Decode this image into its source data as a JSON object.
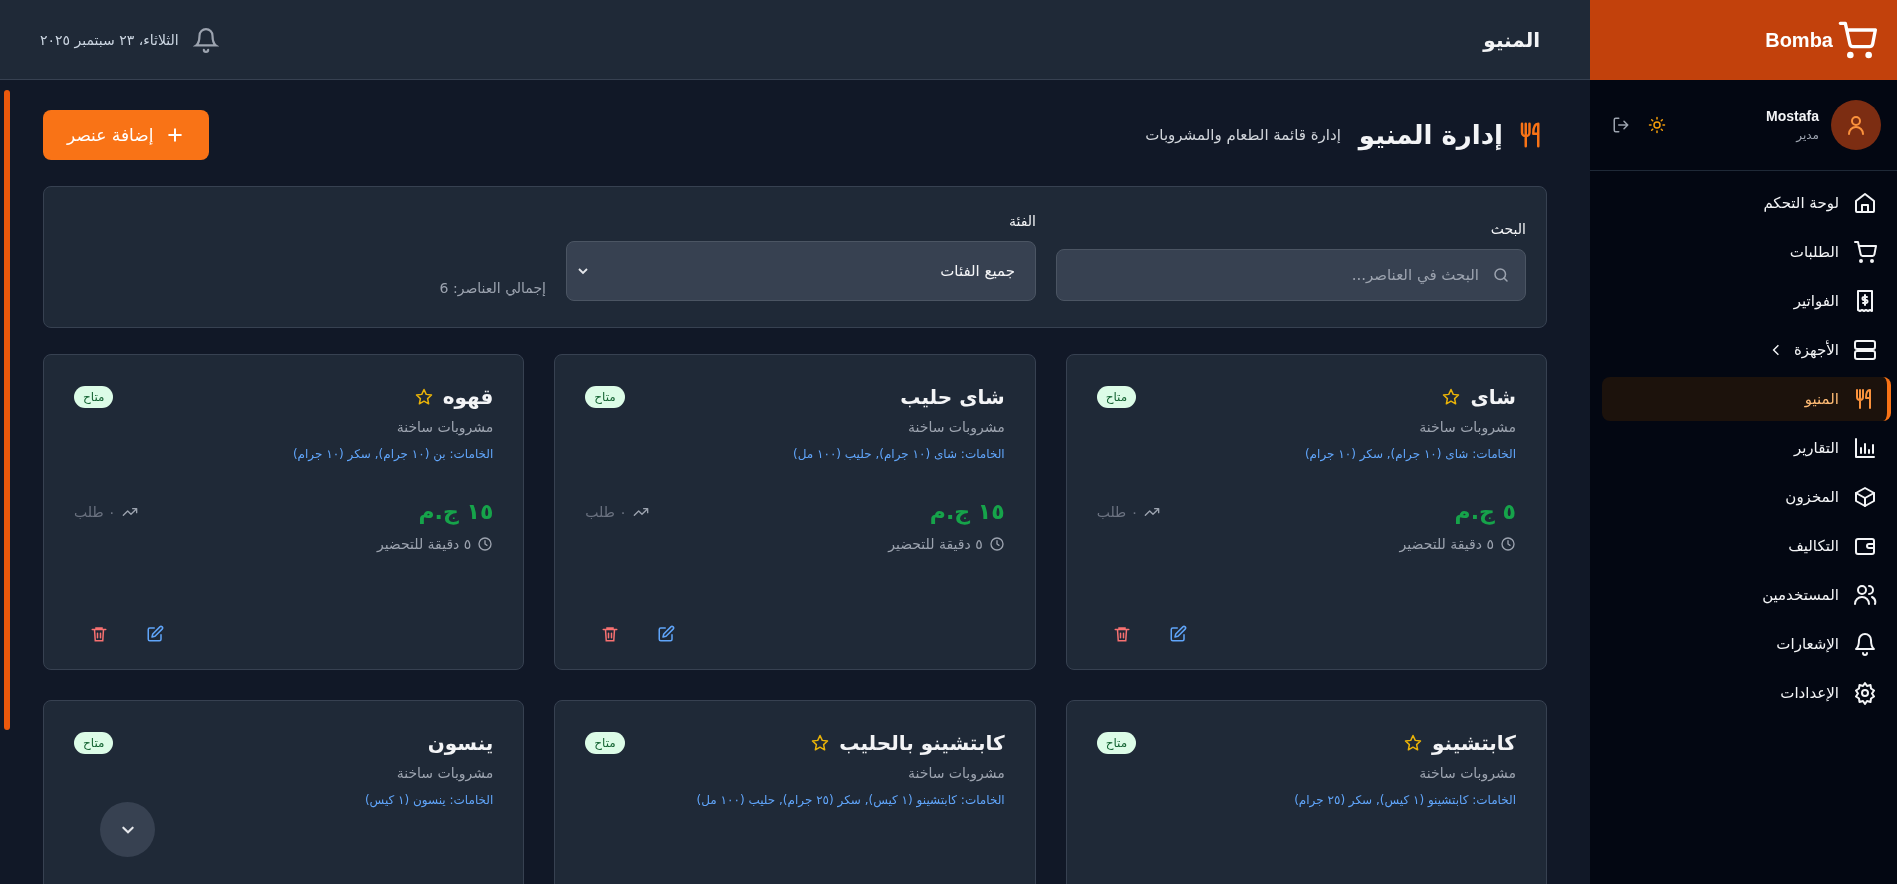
{
  "brand": {
    "name": "Bomba"
  },
  "user": {
    "name": "Mostafa",
    "role": "مدير"
  },
  "sidebar": {
    "items": [
      {
        "label": "لوحة التحكم",
        "selected": false,
        "expandable": false
      },
      {
        "label": "الطلبات",
        "selected": false,
        "expandable": false
      },
      {
        "label": "الفواتير",
        "selected": false,
        "expandable": false
      },
      {
        "label": "الأجهزة",
        "selected": false,
        "expandable": true
      },
      {
        "label": "المنيو",
        "selected": true,
        "expandable": false
      },
      {
        "label": "التقارير",
        "selected": false,
        "expandable": false
      },
      {
        "label": "المخزون",
        "selected": false,
        "expandable": false
      },
      {
        "label": "التكاليف",
        "selected": false,
        "expandable": false
      },
      {
        "label": "المستخدمين",
        "selected": false,
        "expandable": false
      },
      {
        "label": "الإشعارات",
        "selected": false,
        "expandable": false
      },
      {
        "label": "الإعدادات",
        "selected": false,
        "expandable": false
      }
    ]
  },
  "topbar": {
    "title": "المنيو",
    "date": "الثلاثاء، ٢٣ سبتمبر ٢٠٢٥"
  },
  "header": {
    "title": "إدارة المنيو",
    "subtitle": "إدارة قائمة الطعام والمشروبات",
    "add_button": "إضافة عنصر"
  },
  "filters": {
    "search_label": "البحث",
    "search_placeholder": "البحث في العناصر...",
    "category_label": "الفئة",
    "category_value": "جميع الفئات",
    "total": "إجمالي العناصر: 6"
  },
  "items": [
    {
      "name": "شاى",
      "featured": true,
      "available": true,
      "status": "متاح",
      "category": "مشروبات ساخنة",
      "ingredients": "الخامات: شاى (١٠ جرام), سكر (١٠ جرام)",
      "price": "٥ ج.م",
      "orders": "٠ طلب",
      "prep": "٥ دقيقة للتحضير"
    },
    {
      "name": "شاى حليب",
      "featured": false,
      "available": true,
      "status": "متاح",
      "category": "مشروبات ساخنة",
      "ingredients": "الخامات: شاى (١٠ جرام), حليب (١٠٠ مل)",
      "price": "١٥ ج.م",
      "orders": "٠ طلب",
      "prep": "٥ دقيقة للتحضير"
    },
    {
      "name": "قهوه",
      "featured": true,
      "available": true,
      "status": "متاح",
      "category": "مشروبات ساخنة",
      "ingredients": "الخامات: بن (١٠ جرام), سكر (١٠ جرام)",
      "price": "١٥ ج.م",
      "orders": "٠ طلب",
      "prep": "٥ دقيقة للتحضير"
    },
    {
      "name": "كابتشينو",
      "featured": true,
      "available": true,
      "status": "متاح",
      "category": "مشروبات ساخنة",
      "ingredients": "الخامات: كابتشينو (١ كيس), سكر (٢٥ جرام)"
    },
    {
      "name": "كابتشينو بالحليب",
      "featured": true,
      "available": true,
      "status": "متاح",
      "category": "مشروبات ساخنة",
      "ingredients": "الخامات: كابتشينو (١ كيس), سكر (٢٥ جرام), حليب (١٠٠ مل)"
    },
    {
      "name": "ينسون",
      "featured": false,
      "available": true,
      "status": "متاح",
      "category": "مشروبات ساخنة",
      "ingredients": "الخامات: ينسون (١ كيس)"
    }
  ]
}
